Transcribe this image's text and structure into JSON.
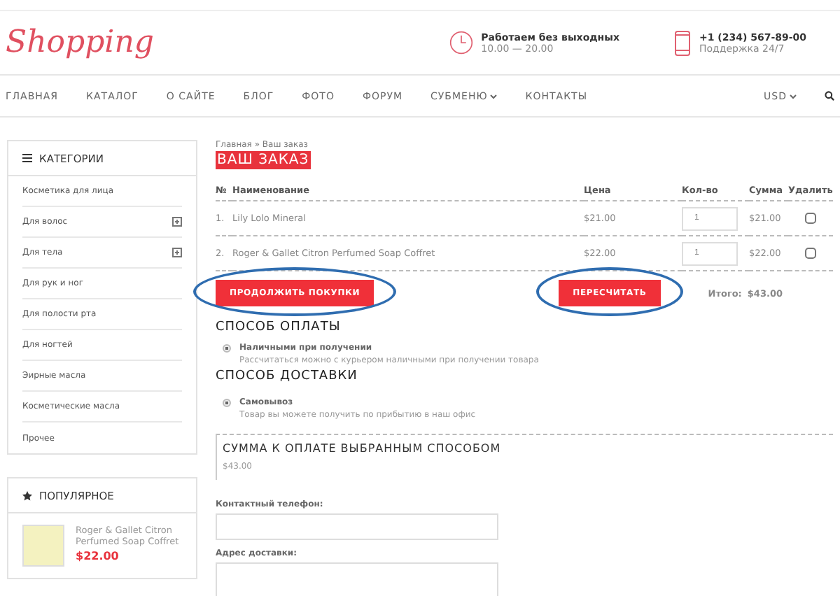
{
  "header": {
    "logo": "Shopping",
    "hours": {
      "title": "Работаем без выходных",
      "detail": "10.00 — 20.00"
    },
    "phone": {
      "title": "+1 (234) 567-89-00",
      "detail": "Поддержка 24/7"
    }
  },
  "nav": {
    "items": [
      {
        "label": "ГЛАВНАЯ",
        "dropdown": false
      },
      {
        "label": "КАТАЛОГ",
        "dropdown": false
      },
      {
        "label": "О САЙТЕ",
        "dropdown": false
      },
      {
        "label": "БЛОГ",
        "dropdown": false
      },
      {
        "label": "ФОТО",
        "dropdown": false
      },
      {
        "label": "ФОРУМ",
        "dropdown": false
      },
      {
        "label": "СУБМЕНЮ",
        "dropdown": true
      },
      {
        "label": "КОНТАКТЫ",
        "dropdown": false
      }
    ],
    "currency": "USD"
  },
  "sidebar": {
    "categories_title": "КАТЕГОРИИ",
    "categories": [
      {
        "label": "Косметика для лица",
        "expandable": false
      },
      {
        "label": "Для волос",
        "expandable": true
      },
      {
        "label": "Для тела",
        "expandable": true
      },
      {
        "label": "Для рук и ног",
        "expandable": false
      },
      {
        "label": "Для полости рта",
        "expandable": false
      },
      {
        "label": "Для ногтей",
        "expandable": false
      },
      {
        "label": "Эирные масла",
        "expandable": false
      },
      {
        "label": "Косметические масла",
        "expandable": false
      },
      {
        "label": "Прочее",
        "expandable": false
      }
    ],
    "popular_title": "ПОПУЛЯРНОЕ",
    "popular": [
      {
        "name": "Roger & Gallet Citron Perfumed Soap Coffret",
        "price": "$22.00"
      }
    ]
  },
  "breadcrumb": "Главная » Ваш заказ",
  "title": "ВАШ ЗАКАЗ",
  "table": {
    "columns": [
      "№",
      "Наименование",
      "Цена",
      "Кол-во",
      "Сумма",
      "Удалить"
    ],
    "rows": [
      {
        "num": "1.",
        "name": "Lily Lolo Mineral",
        "price": "$21.00",
        "qty": "1",
        "sum": "$21.00",
        "delete": false
      },
      {
        "num": "2.",
        "name": "Roger & Gallet Citron Perfumed Soap Coffret",
        "price": "$22.00",
        "qty": "1",
        "sum": "$22.00",
        "delete": false
      }
    ]
  },
  "actions": {
    "continue": "ПРОДОЛЖИТЬ ПОКУПКИ",
    "recalc": "ПЕРЕСЧИТАТЬ",
    "total_label": "Итого:",
    "total": "$43.00"
  },
  "payment": {
    "title": "СПОСОБ ОПЛАТЫ",
    "options": [
      {
        "label": "Наличными при получении",
        "description": "Рассчитаться можно с курьером наличными при получении товара",
        "selected": true
      }
    ]
  },
  "delivery": {
    "title": "СПОСОБ ДОСТАВКИ",
    "options": [
      {
        "label": "Самовывоз",
        "description": "Товар вы можете получить по прибытию в наш офис",
        "selected": true
      }
    ]
  },
  "summary": {
    "title": "СУММА К ОПЛАТЕ ВЫБРАННЫМ СПОСОБОМ",
    "amount": "$43.00"
  },
  "form": {
    "phone_label": "Контактный телефон:",
    "address_label": "Адрес доставки:"
  }
}
